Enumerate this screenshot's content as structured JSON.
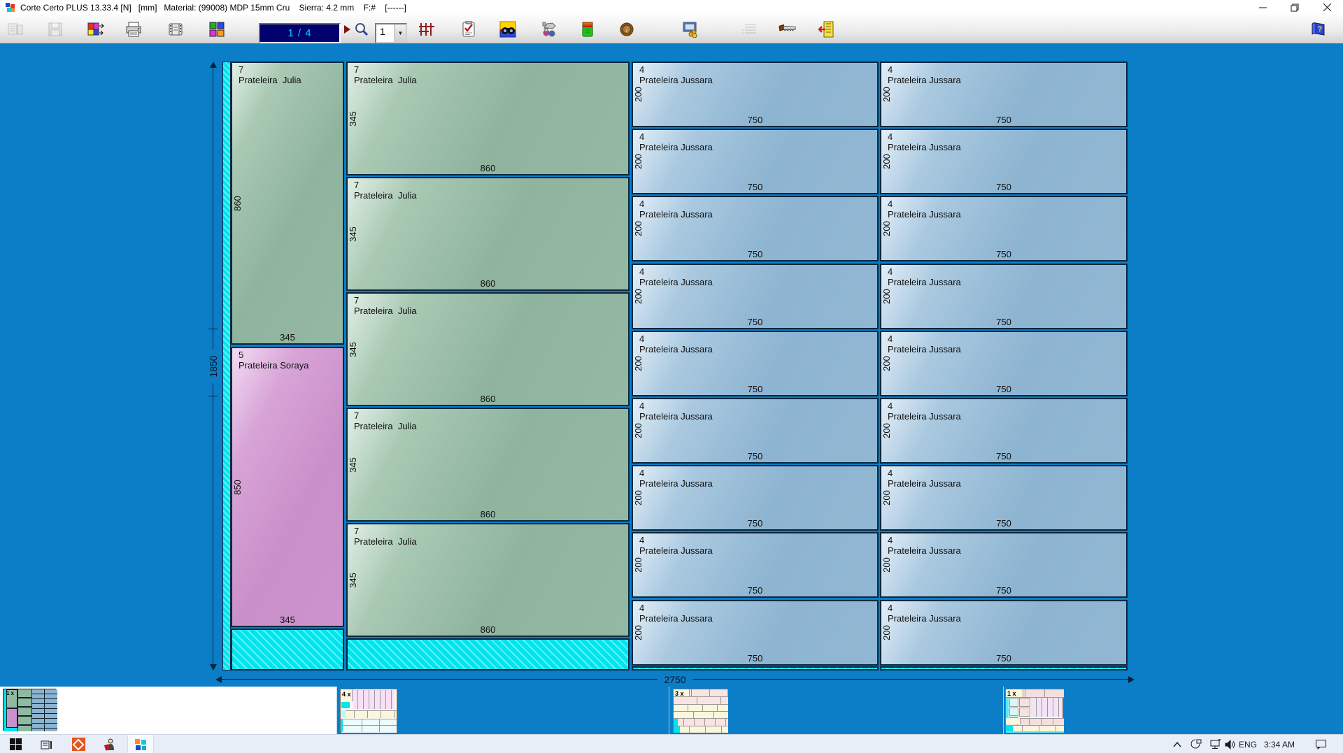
{
  "window": {
    "title": "Corte Certo PLUS 13.33.4 [N]   [mm]   Material: (99008) MDP 15mm Cru    Sierra: 4.2 mm    F:#    [------]",
    "controls": {
      "minimize": "minimize",
      "restore": "restore",
      "close": "close"
    }
  },
  "toolbar": {
    "page_indicator": "1 / 4",
    "zoom_level": "1",
    "icons": [
      "report",
      "save",
      "panel-arrange",
      "print",
      "preview-strip",
      "mosaic",
      "next-page",
      "zoom",
      "grid",
      "checklist",
      "search-binoculars",
      "machining",
      "stock",
      "info-coin",
      "costs",
      "list",
      "saw",
      "exit-door",
      "help-book"
    ],
    "disabled_icons": [
      "report",
      "save",
      "list"
    ]
  },
  "board": {
    "sheet_width": "2750",
    "sheet_height": "1850",
    "colors": {
      "canvas": "#0b7ec7",
      "piece_green": "#94b8a3",
      "piece_pink": "#cd93cd",
      "piece_blue": "#91b7d3",
      "waste_cyan": "#00e4ee",
      "page_box_bg": "#00006e",
      "page_box_text": "#00d9e8"
    },
    "columns": [
      {
        "pieces": [
          {
            "id": "7",
            "name": "Prateleira  Julia",
            "side": "860",
            "bottom": "345",
            "color": "green"
          },
          {
            "id": "5",
            "name": "Prateleira Soraya",
            "side": "850",
            "bottom": "345",
            "color": "pink"
          }
        ]
      },
      {
        "pieces": [
          {
            "id": "7",
            "name": "Prateleira  Julia",
            "side": "345",
            "bottom": "860",
            "color": "green"
          },
          {
            "id": "7",
            "name": "Prateleira  Julia",
            "side": "345",
            "bottom": "860",
            "color": "green"
          },
          {
            "id": "7",
            "name": "Prateleira  Julia",
            "side": "345",
            "bottom": "860",
            "color": "green"
          },
          {
            "id": "7",
            "name": "Prateleira  Julia",
            "side": "345",
            "bottom": "860",
            "color": "green"
          },
          {
            "id": "7",
            "name": "Prateleira  Julia",
            "side": "345",
            "bottom": "860",
            "color": "green"
          }
        ]
      },
      {
        "pieces": [
          {
            "id": "4",
            "name": "Prateleira Jussara",
            "side": "200",
            "bottom": "750",
            "color": "blue"
          },
          {
            "id": "4",
            "name": "Prateleira Jussara",
            "side": "200",
            "bottom": "750",
            "color": "blue"
          },
          {
            "id": "4",
            "name": "Prateleira Jussara",
            "side": "200",
            "bottom": "750",
            "color": "blue"
          },
          {
            "id": "4",
            "name": "Prateleira Jussara",
            "side": "200",
            "bottom": "750",
            "color": "blue"
          },
          {
            "id": "4",
            "name": "Prateleira Jussara",
            "side": "200",
            "bottom": "750",
            "color": "blue"
          },
          {
            "id": "4",
            "name": "Prateleira Jussara",
            "side": "200",
            "bottom": "750",
            "color": "blue"
          },
          {
            "id": "4",
            "name": "Prateleira Jussara",
            "side": "200",
            "bottom": "750",
            "color": "blue"
          },
          {
            "id": "4",
            "name": "Prateleira Jussara",
            "side": "200",
            "bottom": "750",
            "color": "blue"
          },
          {
            "id": "4",
            "name": "Prateleira Jussara",
            "side": "200",
            "bottom": "750",
            "color": "blue"
          }
        ]
      },
      {
        "pieces": [
          {
            "id": "4",
            "name": "Prateleira Jussara",
            "side": "200",
            "bottom": "750",
            "color": "blue"
          },
          {
            "id": "4",
            "name": "Prateleira Jussara",
            "side": "200",
            "bottom": "750",
            "color": "blue"
          },
          {
            "id": "4",
            "name": "Prateleira Jussara",
            "side": "200",
            "bottom": "750",
            "color": "blue"
          },
          {
            "id": "4",
            "name": "Prateleira Jussara",
            "side": "200",
            "bottom": "750",
            "color": "blue"
          },
          {
            "id": "4",
            "name": "Prateleira Jussara",
            "side": "200",
            "bottom": "750",
            "color": "blue"
          },
          {
            "id": "4",
            "name": "Prateleira Jussara",
            "side": "200",
            "bottom": "750",
            "color": "blue"
          },
          {
            "id": "4",
            "name": "Prateleira Jussara",
            "side": "200",
            "bottom": "750",
            "color": "blue"
          },
          {
            "id": "4",
            "name": "Prateleira Jussara",
            "side": "200",
            "bottom": "750",
            "color": "blue"
          },
          {
            "id": "4",
            "name": "Prateleira Jussara",
            "side": "200",
            "bottom": "750",
            "color": "blue"
          }
        ]
      }
    ]
  },
  "filmstrip": {
    "pages": [
      {
        "label": "1 x",
        "selected": true
      },
      {
        "label": "4 x",
        "selected": false
      },
      {
        "label": "3 x",
        "selected": false
      },
      {
        "label": "1 x",
        "selected": false
      }
    ]
  },
  "taskbar": {
    "language": "ENG",
    "time": "3:34 AM"
  }
}
